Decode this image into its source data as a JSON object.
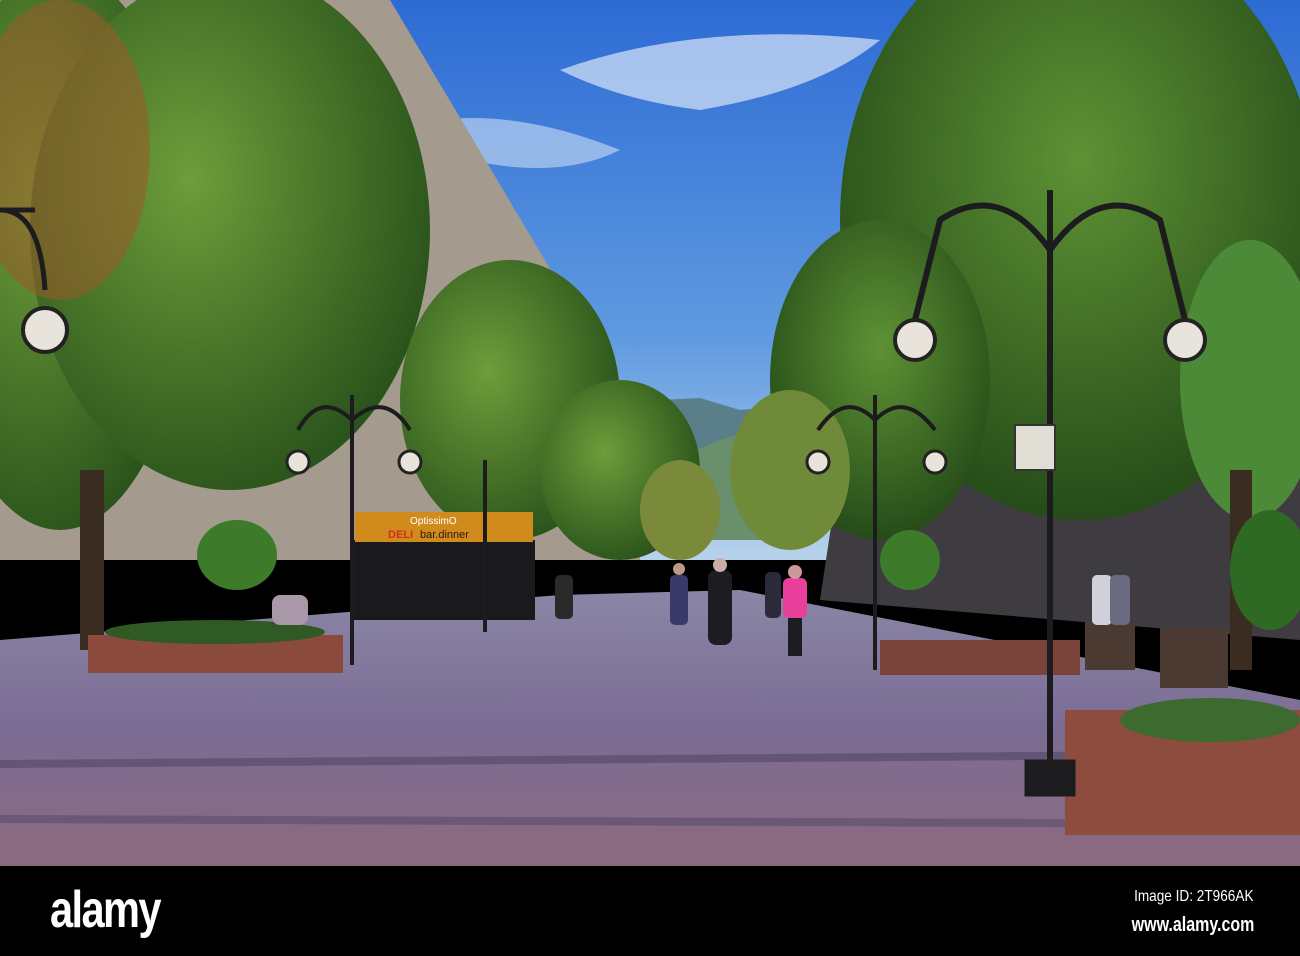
{
  "photo": {
    "shop_sign_top": "OptissimO",
    "shop_sign_deli": "DELI",
    "shop_sign_bottom": "bar.dinner"
  },
  "footer": {
    "logo": "alamy",
    "image_id": "Image ID: 2T966AK",
    "url": "www.alamy.com"
  },
  "colors": {
    "sky_top": "#2f6fd6",
    "sky_bottom": "#a9cbe8",
    "foliage": "#3f7a2a",
    "pavement": "#7a6a8e",
    "sign": "#d18a1c"
  }
}
